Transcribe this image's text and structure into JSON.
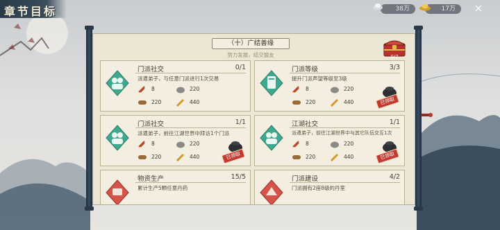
{
  "header": {
    "title": "章节目标"
  },
  "resources": [
    {
      "name": "silver",
      "value": "38万",
      "icon": "silver-ingot-icon"
    },
    {
      "name": "gold",
      "value": "17万",
      "icon": "gold-ingot-icon"
    }
  ],
  "panel": {
    "chapter": "（十）广结善缘",
    "subtitle": "努力发展，结交盟友",
    "chest": {
      "icon": "treasure-chest-icon",
      "count": "0/7"
    }
  },
  "rewards": {
    "rice": "8",
    "stone": "220",
    "wood": "220",
    "grain": "440"
  },
  "claimed_label": "已领取",
  "tasks": [
    {
      "title": "门派社交",
      "progress": "0/1",
      "desc": "派遣弟子，与任意门派进行1次交易",
      "claimed": false,
      "icon": "social-icon"
    },
    {
      "title": "门派等级",
      "progress": "3/3",
      "desc": "提升门派声望等级至3级",
      "claimed": true,
      "icon": "sect-level-icon"
    },
    {
      "title": "门派社交",
      "progress": "1/1",
      "desc": "派遣弟子，前往江湖世界中拜访1个门派",
      "claimed": true,
      "icon": "social-icon"
    },
    {
      "title": "江湖社交",
      "progress": "1/1",
      "desc": "派遣弟子，前往江湖世界中与其它队伍交互1次",
      "claimed": true,
      "icon": "jianghu-icon"
    },
    {
      "title": "物资生产",
      "progress": "15/5",
      "desc": "累计生产5颗任意丹药",
      "claimed": false,
      "icon": "production-icon"
    },
    {
      "title": "门派建设",
      "progress": "4/2",
      "desc": "门派拥有2座8级的丹室",
      "claimed": false,
      "icon": "construction-icon"
    }
  ],
  "colors": {
    "accent_teal": "#3ea891",
    "claimed_red": "#c23a2f",
    "panel_bg": "#ece6d4"
  }
}
